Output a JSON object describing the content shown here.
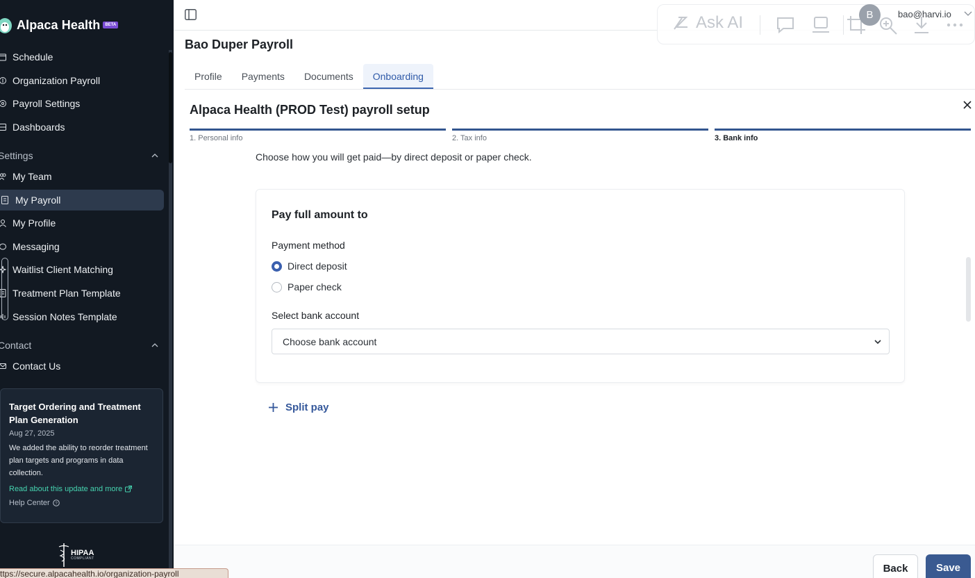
{
  "brand": {
    "name": "Alpaca Health",
    "badge": "BETA"
  },
  "sidebar": {
    "top_items": [
      {
        "label": "Schedule",
        "icon": "calendar-icon"
      },
      {
        "label": "Organization Payroll",
        "icon": "payroll-icon"
      },
      {
        "label": "Payroll Settings",
        "icon": "settings-icon"
      },
      {
        "label": "Dashboards",
        "icon": "dashboard-icon"
      }
    ],
    "settings_header": "Settings",
    "settings_items": [
      {
        "label": "My Team",
        "icon": "team-icon"
      },
      {
        "label": "My Payroll",
        "icon": "receipt-icon",
        "active": true
      },
      {
        "label": "My Profile",
        "icon": "user-icon"
      },
      {
        "label": "Messaging",
        "icon": "chat-icon"
      },
      {
        "label": "Waitlist Client Matching",
        "icon": "sparkle-icon"
      },
      {
        "label": "Treatment Plan Template",
        "icon": "document-icon"
      },
      {
        "label": "Session Notes Template",
        "icon": "audio-icon"
      }
    ],
    "contact_header": "Contact",
    "contact_items": [
      {
        "label": "Contact Us",
        "icon": "mail-icon"
      }
    ],
    "update_card": {
      "title": "Target Ordering and Treatment Plan Generation",
      "date": "Aug 27, 2025",
      "body": "We added the ability to reorder treatment plan targets and programs in data collection.",
      "link": "Read about this update and more",
      "help": "Help Center"
    },
    "hipaa": {
      "title": "HIPAA",
      "subtitle": "COMPLIANT"
    }
  },
  "status_url": "ttps://secure.alpacahealth.io/organization-payroll",
  "toolbar": {
    "ask_ai": "Ask AI"
  },
  "user": {
    "avatar_initial": "B",
    "email": "bao@harvi.io"
  },
  "page": {
    "title": "Bao Duper Payroll",
    "tabs": [
      "Profile",
      "Payments",
      "Documents",
      "Onboarding"
    ],
    "active_tab": "Onboarding"
  },
  "setup": {
    "title": "Alpaca Health (PROD Test) payroll setup",
    "steps": [
      "1. Personal info",
      "2. Tax info",
      "3. Bank info"
    ],
    "current_step": 3,
    "instruction": "Choose how you will get paid—by direct deposit or paper check.",
    "card": {
      "title": "Pay full amount to",
      "payment_method_label": "Payment method",
      "options": [
        "Direct deposit",
        "Paper check"
      ],
      "selected_option": "Direct deposit",
      "bank_label": "Select bank account",
      "bank_placeholder": "Choose bank account"
    },
    "split_pay": "Split pay"
  },
  "footer": {
    "back": "Back",
    "save": "Save"
  },
  "colors": {
    "sidebar_bg": "#121922",
    "accent": "#3a5a91",
    "tab_active": "#2f5aa8",
    "link_green": "#46d4b0"
  }
}
